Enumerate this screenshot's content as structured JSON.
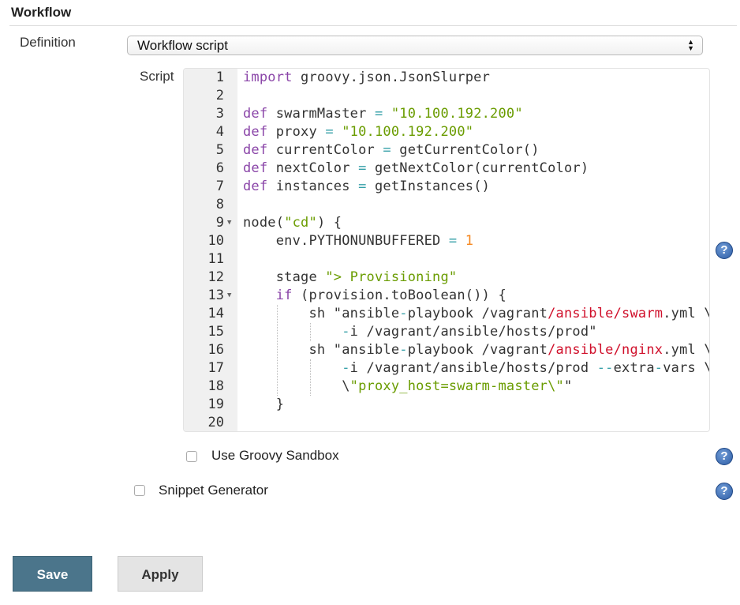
{
  "section": {
    "title": "Workflow"
  },
  "definition": {
    "label": "Definition",
    "selected": "Workflow script"
  },
  "script": {
    "label": "Script",
    "lines": [
      {
        "n": "1",
        "tokens": [
          [
            "import",
            "kw"
          ],
          [
            " groovy.json.JsonSlurper",
            ""
          ]
        ]
      },
      {
        "n": "2",
        "tokens": []
      },
      {
        "n": "3",
        "tokens": [
          [
            "def",
            "kw"
          ],
          [
            " swarmMaster ",
            ""
          ],
          [
            "=",
            "op"
          ],
          [
            " ",
            ""
          ],
          [
            "\"10.100.192.200\"",
            "str"
          ]
        ]
      },
      {
        "n": "4",
        "tokens": [
          [
            "def",
            "kw"
          ],
          [
            " proxy ",
            ""
          ],
          [
            "=",
            "op"
          ],
          [
            " ",
            ""
          ],
          [
            "\"10.100.192.200\"",
            "str"
          ]
        ]
      },
      {
        "n": "5",
        "tokens": [
          [
            "def",
            "kw"
          ],
          [
            " currentColor ",
            ""
          ],
          [
            "=",
            "op"
          ],
          [
            " getCurrentColor()",
            ""
          ]
        ]
      },
      {
        "n": "6",
        "tokens": [
          [
            "def",
            "kw"
          ],
          [
            " nextColor ",
            ""
          ],
          [
            "=",
            "op"
          ],
          [
            " getNextColor(currentColor)",
            ""
          ]
        ]
      },
      {
        "n": "7",
        "tokens": [
          [
            "def",
            "kw"
          ],
          [
            " instances ",
            ""
          ],
          [
            "=",
            "op"
          ],
          [
            " getInstances()",
            ""
          ]
        ]
      },
      {
        "n": "8",
        "tokens": []
      },
      {
        "n": "9",
        "fold": true,
        "tokens": [
          [
            "node(",
            ""
          ],
          [
            "\"cd\"",
            "str"
          ],
          [
            ") {",
            ""
          ]
        ]
      },
      {
        "n": "10",
        "tokens": [
          [
            "    env.PYTHONUNBUFFERED ",
            ""
          ],
          [
            "=",
            "op"
          ],
          [
            " ",
            ""
          ],
          [
            "1",
            "num"
          ]
        ]
      },
      {
        "n": "11",
        "tokens": []
      },
      {
        "n": "12",
        "tokens": [
          [
            "    stage ",
            ""
          ],
          [
            "\"> Provisioning\"",
            "str"
          ]
        ]
      },
      {
        "n": "13",
        "fold": true,
        "tokens": [
          [
            "    ",
            ""
          ],
          [
            "if",
            "kw"
          ],
          [
            " (provision.toBoolean()) {",
            ""
          ]
        ]
      },
      {
        "n": "14",
        "tokens": [
          [
            "        sh \"ansible",
            ""
          ],
          [
            "-",
            "op"
          ],
          [
            "playbook /vagrant",
            ""
          ],
          [
            "/ansible/swarm",
            "red"
          ],
          [
            ".yml \\",
            ""
          ]
        ]
      },
      {
        "n": "15",
        "tokens": [
          [
            "            ",
            ""
          ],
          [
            "-",
            "op"
          ],
          [
            "i /vagrant/ansible/hosts/prod\"",
            ""
          ]
        ]
      },
      {
        "n": "16",
        "tokens": [
          [
            "        sh \"ansible",
            ""
          ],
          [
            "-",
            "op"
          ],
          [
            "playbook /vagrant",
            ""
          ],
          [
            "/ansible/nginx",
            "red"
          ],
          [
            ".yml \\",
            ""
          ]
        ]
      },
      {
        "n": "17",
        "tokens": [
          [
            "            ",
            ""
          ],
          [
            "-",
            "op"
          ],
          [
            "i /vagrant/ansible/hosts/prod ",
            ""
          ],
          [
            "--",
            "op"
          ],
          [
            "extra",
            ""
          ],
          [
            "-",
            "op"
          ],
          [
            "vars \\",
            ""
          ]
        ]
      },
      {
        "n": "18",
        "tokens": [
          [
            "            \\",
            ""
          ],
          [
            "\"proxy_host=swarm-master\\\"",
            "str"
          ],
          [
            "\"",
            ""
          ]
        ]
      },
      {
        "n": "19",
        "tokens": [
          [
            "    }",
            ""
          ]
        ]
      },
      {
        "n": "20",
        "tokens": []
      }
    ]
  },
  "sandbox": {
    "label": "Use Groovy Sandbox",
    "checked": false
  },
  "snippet": {
    "label": "Snippet Generator",
    "checked": false
  },
  "help_icon": "question-circle-icon",
  "buttons": {
    "save": "Save",
    "apply": "Apply"
  },
  "colors": {
    "save_button": "#4b758b",
    "keyword": "#8a45a8",
    "string": "#6a9c00",
    "number": "#f5871f",
    "operator": "#36a0a8",
    "path_highlight": "#d0102b"
  }
}
